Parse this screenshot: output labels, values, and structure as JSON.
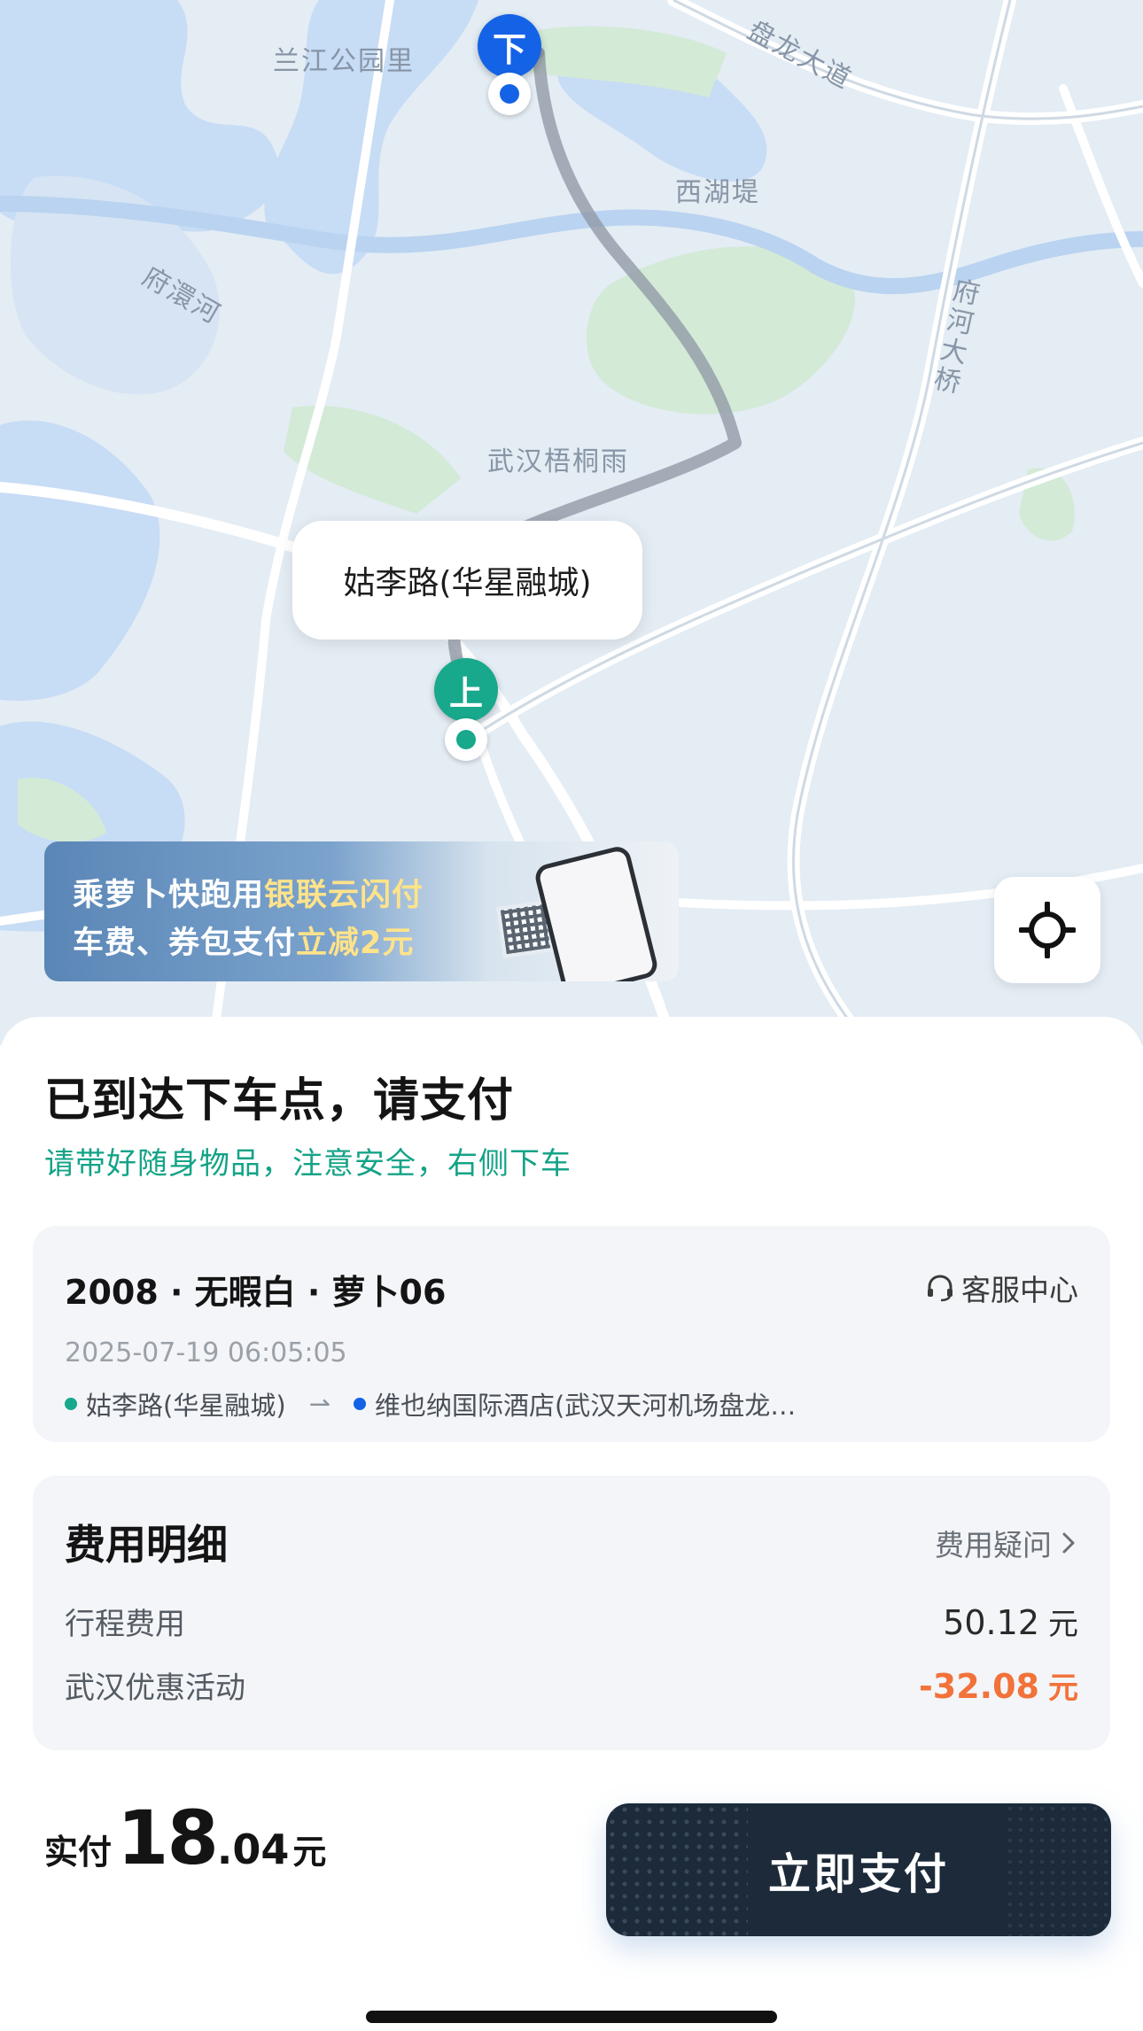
{
  "map": {
    "labels": {
      "lanjiang_park": "兰江公园里",
      "road_top_right": "盘龙大道",
      "xihu_di": "西湖堤",
      "fuhuan_river": "府澴河",
      "fuhe_bridge": "府河大桥",
      "wuhan_wutongyu": "武汉梧桐雨"
    },
    "pickup_bubble": "姑李路(华星融城)",
    "drop_pin": "下",
    "pickup_pin": "上",
    "promo": {
      "line1_prefix": "乘萝卜快跑用",
      "line1_highlight": "银联云闪付",
      "line2_prefix": "车费、券包支付",
      "line2_highlight": "立减2元"
    },
    "colors": {
      "water": "#c7dcf5",
      "green": "#d3ead6",
      "road": "#ffffff",
      "route": "#8d96a3"
    }
  },
  "sheet": {
    "title": "已到达下车点，请支付",
    "subtitle": "请带好随身物品，注意安全，右侧下车",
    "trip": {
      "vehicle": "2008 · 无暇白 · 萝卜06",
      "service_label": "客服中心",
      "service_icon": "headset-icon",
      "time": "2025-07-19 06:05:05",
      "from": "姑李路(华星融城)",
      "to": "维也纳国际酒店(武汉天河机场盘龙…",
      "arrow": "⇀"
    },
    "fee": {
      "title": "费用明细",
      "question": "费用疑问",
      "rows": [
        {
          "label": "行程费用",
          "value": "50.12",
          "unit": "元"
        },
        {
          "label": "武汉优惠活动",
          "value": "-32.08",
          "unit": "元"
        }
      ]
    },
    "total": {
      "label": "实付",
      "integer": "18",
      "decimal": ".04",
      "unit": "元"
    },
    "pay_button": "立即支付",
    "colors": {
      "accent_green": "#14a387",
      "discount_orange": "#f2723a",
      "pay_button": "#1c2a3a"
    }
  }
}
